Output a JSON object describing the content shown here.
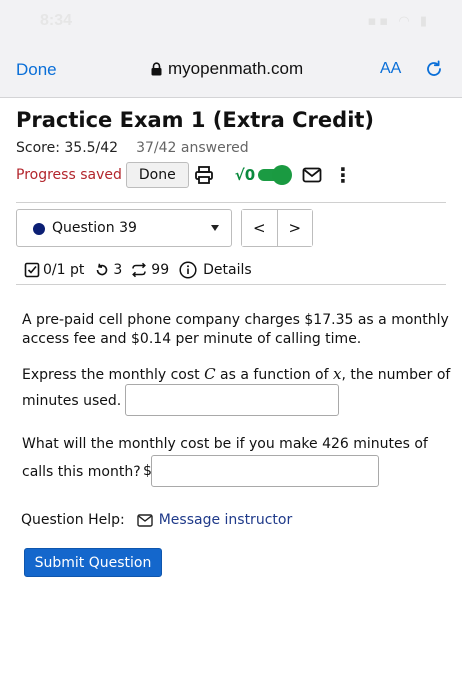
{
  "status_bar": {
    "time": "8:34"
  },
  "browser": {
    "done_label": "Done",
    "url": "myopenmath.com",
    "text_size_label": "AA"
  },
  "assessment": {
    "title": "Practice Exam 1 (Extra Credit)",
    "score": "Score: 35.5/42",
    "answered": "37/42 answered",
    "progress_status": "Progress saved",
    "done_label": "Done"
  },
  "question_nav": {
    "selected_question": "Question 39",
    "prev_label": "<",
    "next_label": ">"
  },
  "question_meta": {
    "points": "0/1 pt",
    "retries": "3",
    "attempts": "99",
    "details_label": "Details"
  },
  "question": {
    "intro_line1": "A pre-paid cell phone company charges $17.35 as a monthly",
    "intro_line2": "access fee and $0.14 per minute of calling time.",
    "part1_before": "Express the monthly cost ",
    "part1_var1": "C",
    "part1_mid": " as a function of ",
    "part1_var2": "x",
    "part1_after": ", the number of",
    "part1_line2": "minutes used.",
    "part1_value": "",
    "part2_line1": "What will the monthly cost be if you make 426 minutes of",
    "part2_line2": "calls this month?",
    "currency_symbol": "$",
    "part2_value": ""
  },
  "help": {
    "label": "Question Help:",
    "message_label": "Message instructor"
  },
  "submit_label": "Submit Question",
  "colors": {
    "link_blue": "#0a6fd8",
    "progress_red": "#b3262d",
    "accent_green": "#1b9b43",
    "submit_blue": "#1467cc",
    "question_dot": "#0b1f74"
  }
}
